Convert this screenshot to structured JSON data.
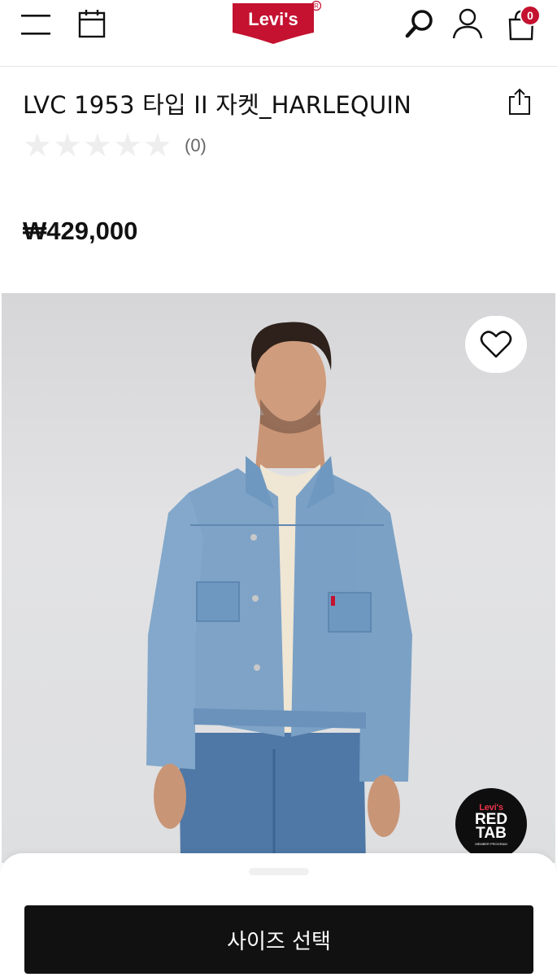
{
  "header": {
    "logo_text": "Levi's",
    "cart_count": "0",
    "brand_color": "#c41230"
  },
  "product": {
    "title": "LVC 1953 타입 II 자켓_HARLEQUIN",
    "rating_stars": 0,
    "review_count": "(0)",
    "price": "₩429,000"
  },
  "badge": {
    "line1": "Levi's",
    "line2": "RED",
    "line3": "TAB",
    "line4": "MEMBER PROGRAM"
  },
  "actions": {
    "size_select_label": "사이즈 선택"
  },
  "icons": [
    "menu-icon",
    "calendar-icon",
    "search-icon",
    "user-icon",
    "shopping-bag-icon",
    "share-icon",
    "heart-icon"
  ]
}
